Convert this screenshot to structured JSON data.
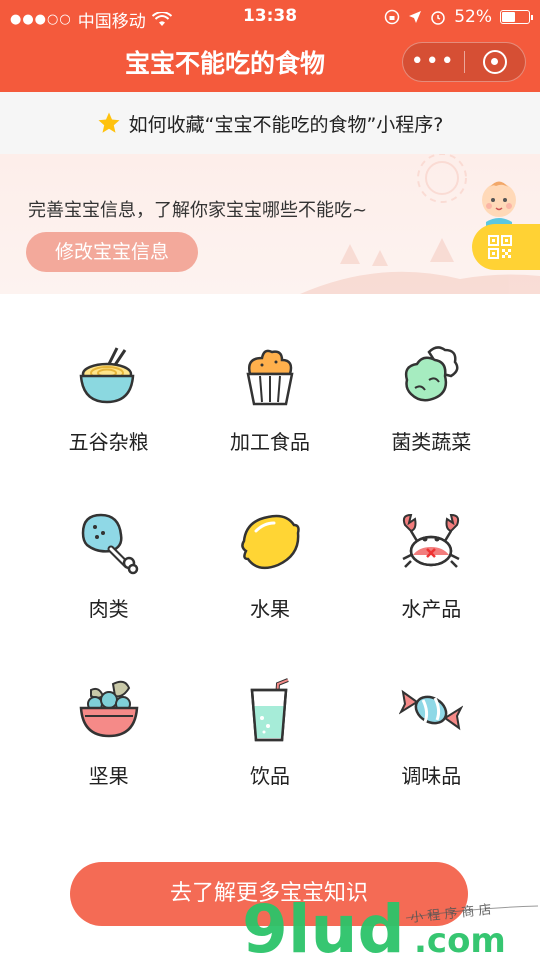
{
  "status_bar": {
    "carrier": "中国移动",
    "time": "13:38",
    "battery_percent": "52%",
    "battery_level": 0.52
  },
  "navbar": {
    "title": "宝宝不能吃的食物",
    "more_label": "•••"
  },
  "tip": {
    "text": "如何收藏“宝宝不能吃的食物”小程序?"
  },
  "banner": {
    "message": "完善宝宝信息，了解你家宝宝哪些不能吃~",
    "edit_button": "修改宝宝信息"
  },
  "categories": [
    {
      "label": "五谷杂粮",
      "icon": "noodle-bowl-icon"
    },
    {
      "label": "加工食品",
      "icon": "cupcake-icon"
    },
    {
      "label": "菌类蔬菜",
      "icon": "cauliflower-icon"
    },
    {
      "label": "肉类",
      "icon": "drumstick-icon"
    },
    {
      "label": "水果",
      "icon": "lemon-icon"
    },
    {
      "label": "水产品",
      "icon": "crab-icon"
    },
    {
      "label": "坚果",
      "icon": "nut-bowl-icon"
    },
    {
      "label": "饮品",
      "icon": "drink-cup-icon"
    },
    {
      "label": "调味品",
      "icon": "candy-icon"
    }
  ],
  "cta": {
    "label": "去了解更多宝宝知识"
  },
  "watermark": {
    "text": "9lud.com",
    "sub": "小 程 序 商 店"
  },
  "colors": {
    "brand": "#f45a3c",
    "cta": "#f46b55",
    "edit_button": "#f3a99b",
    "qr_tab": "#ffd234"
  }
}
